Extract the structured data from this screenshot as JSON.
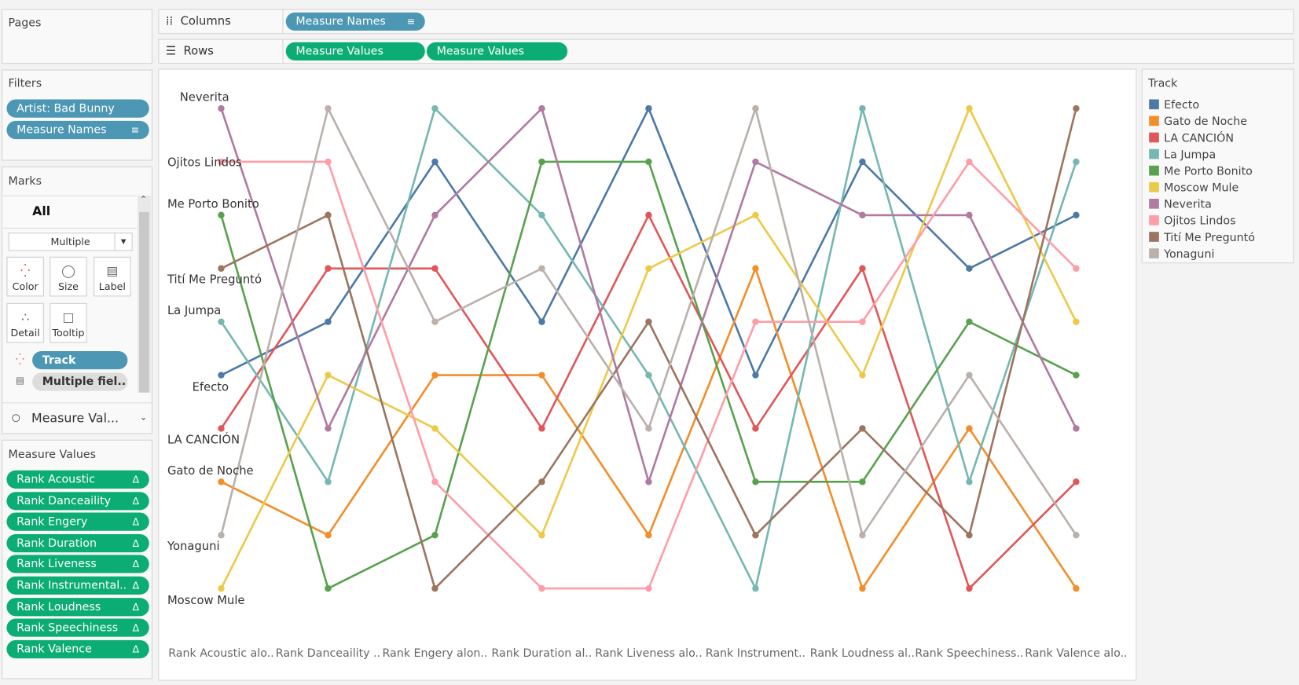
{
  "pages": {
    "title": "Pages"
  },
  "columns": {
    "label": "Columns",
    "pill": "Measure Names"
  },
  "rows": {
    "label": "Rows",
    "pills": [
      "Measure Values",
      "Measure Values"
    ]
  },
  "filters": {
    "title": "Filters",
    "items": [
      "Artist: Bad Bunny",
      "Measure Names"
    ]
  },
  "marks": {
    "title": "Marks",
    "card": "All",
    "mark_type": "Multiple",
    "buttons": [
      "Color",
      "Size",
      "Label",
      "Detail",
      "Tooltip"
    ],
    "fields": [
      "Track",
      "Multiple fiel.."
    ],
    "measure_card": "Measure Val..."
  },
  "measure_values": {
    "title": "Measure Values",
    "items": [
      "Rank Acoustic",
      "Rank Danceaility",
      "Rank Engery",
      "Rank Duration",
      "Rank Liveness",
      "Rank Instrumental..",
      "Rank Loudness",
      "Rank Speechiness",
      "Rank Valence"
    ]
  },
  "legend": {
    "title": "Track"
  },
  "chart_data": {
    "type": "line",
    "title": "",
    "xlabel": "",
    "ylabel": "",
    "categories": [
      "Rank Acoustic alo..",
      "Rank Danceaility ..",
      "Rank Engery alon..",
      "Rank Duration al..",
      "Rank Liveness alo..",
      "Rank Instrument..",
      "Rank Loudness al..",
      "Rank Speechiness..",
      "Rank Valence alo.."
    ],
    "ylim": [
      1,
      10
    ],
    "y_reversed": true,
    "legend_position": "right",
    "series": [
      {
        "name": "Efecto",
        "color": "#4e79a7",
        "values": [
          6,
          5,
          2,
          5,
          1,
          6,
          2,
          4,
          3
        ]
      },
      {
        "name": "Gato de Noche",
        "color": "#f28e2b",
        "values": [
          8,
          9,
          6,
          6,
          9,
          4,
          10,
          7,
          10
        ]
      },
      {
        "name": "LA CANCIÓN",
        "color": "#e15759",
        "values": [
          7,
          4,
          4,
          7,
          3,
          7,
          4,
          10,
          8
        ]
      },
      {
        "name": "La Jumpa",
        "color": "#76b7b2",
        "values": [
          5,
          8,
          1,
          3,
          6,
          10,
          1,
          8,
          2
        ]
      },
      {
        "name": "Me Porto Bonito",
        "color": "#59a14f",
        "values": [
          3,
          10,
          9,
          2,
          2,
          8,
          8,
          5,
          6
        ]
      },
      {
        "name": "Moscow Mule",
        "color": "#edc948",
        "values": [
          10,
          6,
          7,
          9,
          4,
          3,
          6,
          1,
          5
        ]
      },
      {
        "name": "Neverita",
        "color": "#b07aa1",
        "values": [
          1,
          7,
          3,
          1,
          8,
          2,
          3,
          3,
          7
        ]
      },
      {
        "name": "Ojitos Lindos",
        "color": "#ff9da7",
        "values": [
          2,
          2,
          8,
          10,
          10,
          5,
          5,
          2,
          4
        ]
      },
      {
        "name": "Tití Me Preguntó",
        "color": "#9c755f",
        "values": [
          4,
          3,
          10,
          8,
          5,
          9,
          7,
          9,
          1
        ]
      },
      {
        "name": "Yonaguni",
        "color": "#bab0ac",
        "values": [
          9,
          1,
          5,
          4,
          7,
          1,
          9,
          6,
          9
        ]
      }
    ]
  }
}
